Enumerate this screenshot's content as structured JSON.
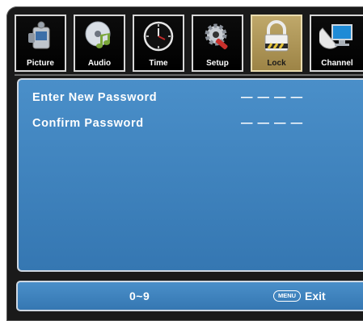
{
  "tabs": [
    {
      "label": "Picture",
      "icon": "camera-icon",
      "selected": false
    },
    {
      "label": "Audio",
      "icon": "audio-disc-icon",
      "selected": false
    },
    {
      "label": "Time",
      "icon": "clock-icon",
      "selected": false
    },
    {
      "label": "Setup",
      "icon": "wrench-gear-icon",
      "selected": false
    },
    {
      "label": "Lock",
      "icon": "padlock-icon",
      "selected": true
    },
    {
      "label": "Channel",
      "icon": "satellite-dish-icon",
      "selected": false
    }
  ],
  "form": {
    "new_password": {
      "label": "Enter New Password",
      "value": "— — — —"
    },
    "confirm_password": {
      "label": "Confirm Password",
      "value": "— — — —"
    }
  },
  "footer": {
    "range": "0~9",
    "menu_key": "MENU",
    "exit_label": "Exit"
  },
  "colors": {
    "panel": "#3f84c0",
    "selected_tab": "#b09a5a",
    "frame": "#1a1a1a"
  }
}
